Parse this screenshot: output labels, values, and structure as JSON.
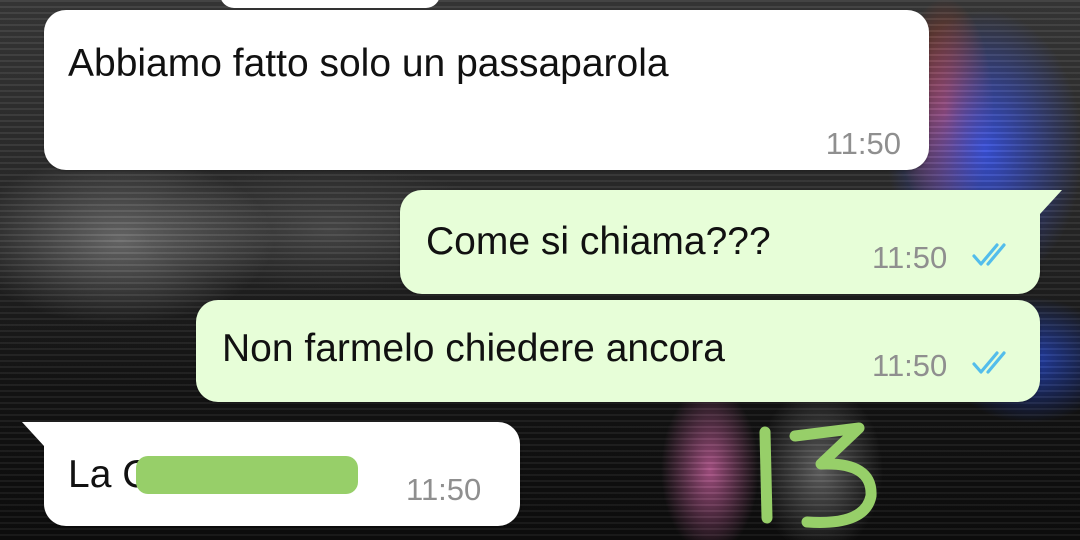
{
  "messages": [
    {
      "direction": "incoming",
      "text": "Abbiamo fatto solo un passaparola",
      "time": "11:50"
    },
    {
      "direction": "outgoing",
      "text": "Come si chiama???",
      "time": "11:50",
      "status": "read"
    },
    {
      "direction": "outgoing",
      "text": "Non farmelo chiedere ancora",
      "time": "11:50",
      "status": "read"
    },
    {
      "direction": "incoming",
      "text": "La C",
      "time": "11:50",
      "redacted": true
    }
  ],
  "annotation": {
    "text": "13",
    "color": "#97cf69"
  },
  "colors": {
    "incoming_bubble": "#ffffff",
    "outgoing_bubble": "#e7fed8",
    "read_tick": "#53bdeb",
    "redaction": "#97cf69"
  },
  "icons": {
    "read_receipt": "double-check-icon"
  }
}
